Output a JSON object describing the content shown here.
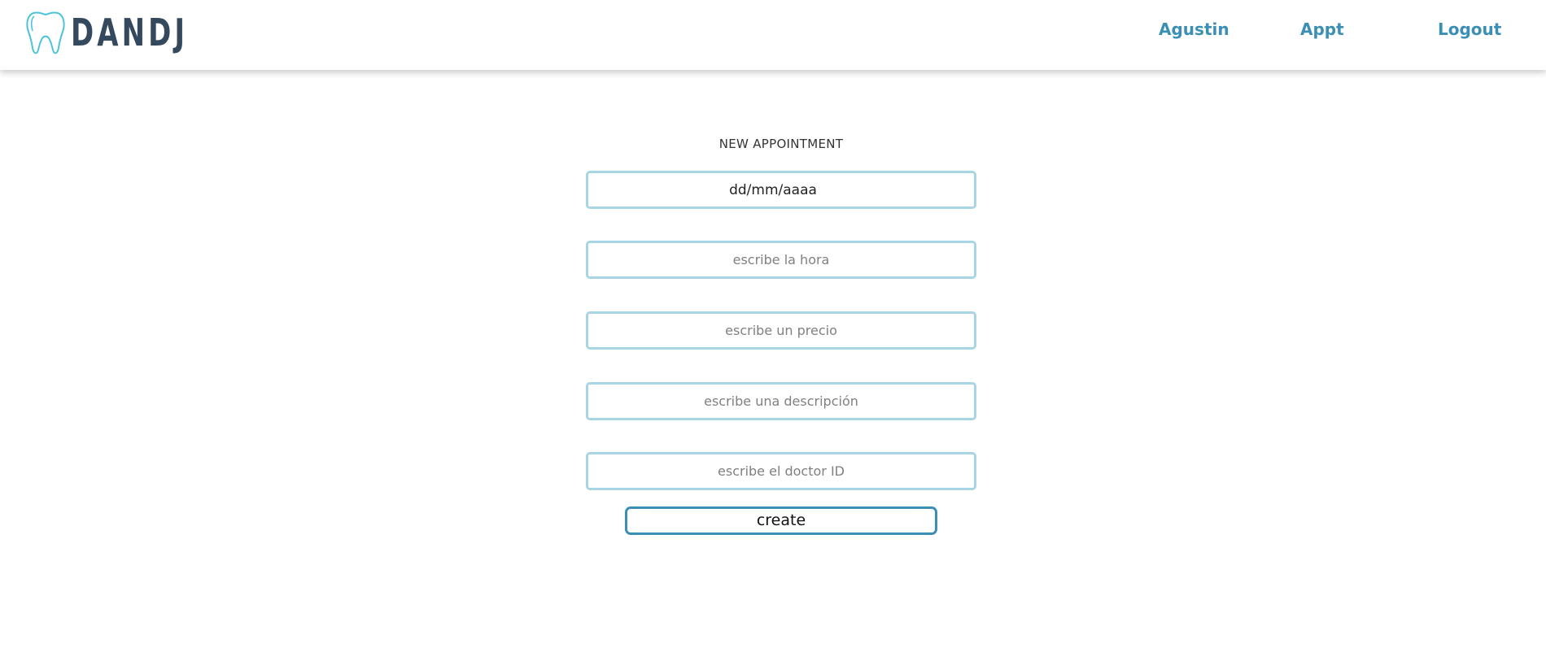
{
  "header": {
    "brand_name": "DANDJ",
    "logo_icon": "tooth-icon",
    "nav": {
      "user_label": "Agustin",
      "appt_label": "Appt",
      "logout_label": "Logout"
    }
  },
  "form": {
    "title": "NEW APPOINTMENT",
    "date_value": "dd/mm/aaaa",
    "time_placeholder": "escribe la hora",
    "price_placeholder": "escribe un precio",
    "description_placeholder": "escribe una descripción",
    "doctor_placeholder": "escribe el doctor ID",
    "submit_label": "create"
  },
  "colors": {
    "brand_text": "#34495e",
    "nav_link": "#3b8fb5",
    "input_border": "#a8d5e3",
    "button_border": "#3b8fb5",
    "tooth_outline": "#4cc3d9"
  }
}
